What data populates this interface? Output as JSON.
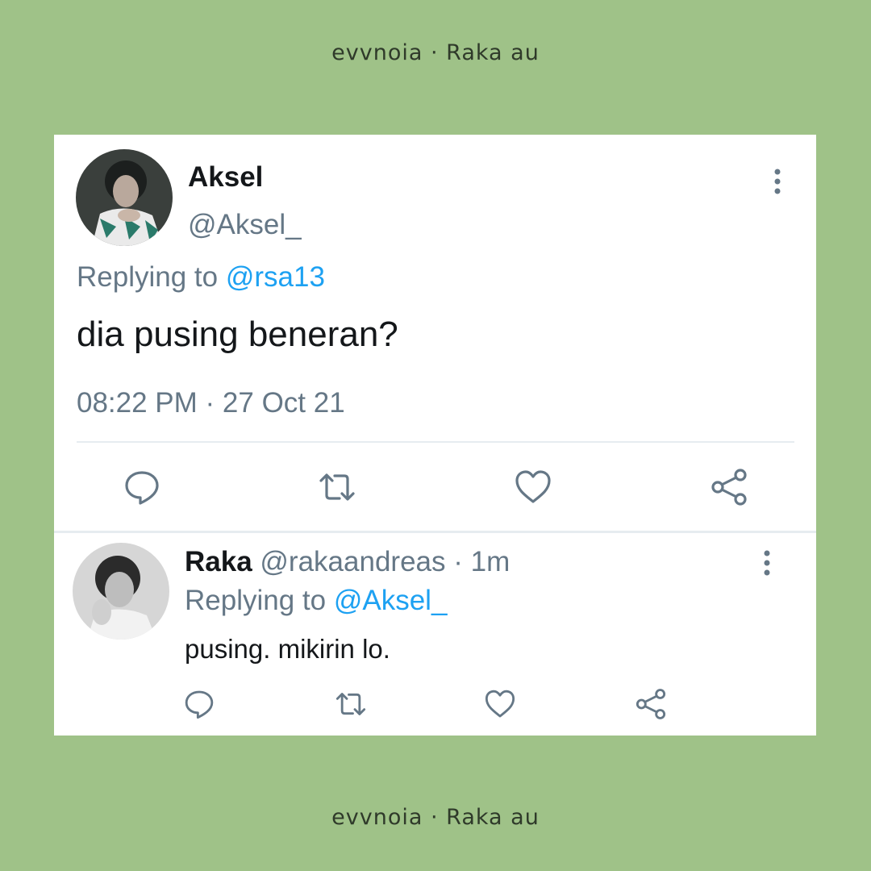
{
  "caption_top": "evvnoia · Raka au",
  "caption_bottom": "evvnoia · Raka au",
  "main_tweet": {
    "name": "Aksel",
    "handle": "@Aksel_",
    "replying_prefix": "Replying to",
    "replying_to": "@rsa13",
    "text": "dia pusing beneran?",
    "timestamp": "08:22 PM · 27 Oct 21",
    "actions": [
      "reply-icon",
      "retweet-icon",
      "like-icon",
      "share-icon"
    ]
  },
  "reply_tweet": {
    "name": "Raka",
    "handle_time": "@rakaandreas · 1m",
    "replying_prefix": "Replying to",
    "replying_to": "@Aksel_",
    "text": "pusing. mikirin lo.",
    "actions": [
      "reply-icon",
      "retweet-icon",
      "like-icon",
      "share-icon"
    ]
  },
  "colors": {
    "background": "#9fc288",
    "card": "#ffffff",
    "secondary_text": "#657786",
    "link": "#1da1f2",
    "icon": "#657786"
  }
}
